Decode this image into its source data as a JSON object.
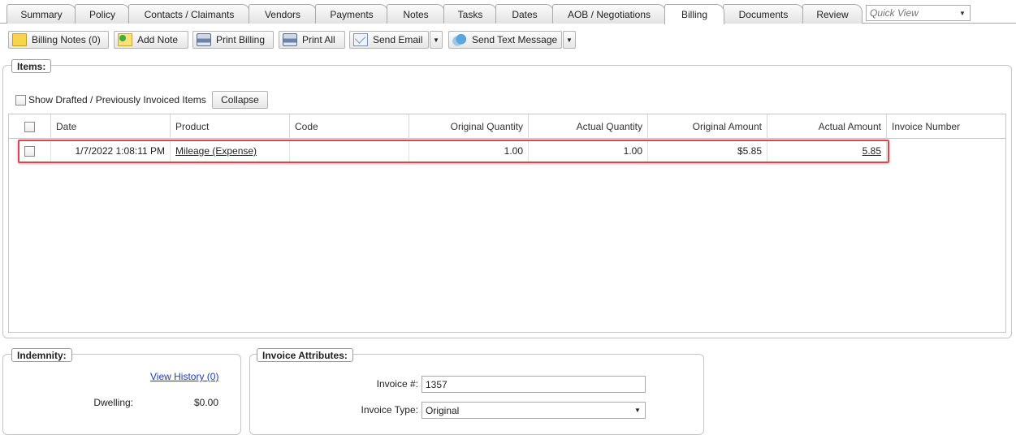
{
  "tabs": [
    {
      "label": "Summary"
    },
    {
      "label": "Policy"
    },
    {
      "label": "Contacts / Claimants"
    },
    {
      "label": "Vendors"
    },
    {
      "label": "Payments"
    },
    {
      "label": "Notes"
    },
    {
      "label": "Tasks"
    },
    {
      "label": "Dates"
    },
    {
      "label": "AOB / Negotiations"
    },
    {
      "label": "Billing",
      "active": true
    },
    {
      "label": "Documents"
    },
    {
      "label": "Review"
    }
  ],
  "quick_view": {
    "placeholder": "Quick View"
  },
  "toolbar": {
    "billing_notes": "Billing Notes (0)",
    "add_note": "Add Note",
    "print_billing": "Print Billing",
    "print_all": "Print All",
    "send_email": "Send Email",
    "send_text": "Send Text Message"
  },
  "items": {
    "legend": "Items:",
    "show_drafted_label": "Show Drafted / Previously Invoiced Items",
    "collapse_label": "Collapse",
    "columns": {
      "date": "Date",
      "product": "Product",
      "code": "Code",
      "original_quantity": "Original Quantity",
      "actual_quantity": "Actual Quantity",
      "original_amount": "Original Amount",
      "actual_amount": "Actual Amount",
      "invoice_number": "Invoice Number"
    },
    "rows": [
      {
        "date": "1/7/2022 1:08:11 PM",
        "product": "Mileage (Expense)",
        "code": "",
        "original_quantity": "1.00",
        "actual_quantity": "1.00",
        "original_amount": "$5.85",
        "actual_amount": "5.85",
        "invoice_number": ""
      }
    ]
  },
  "indemnity": {
    "legend": "Indemnity:",
    "view_history": "View History (0)",
    "dwelling_label": "Dwelling:",
    "dwelling_value": "$0.00"
  },
  "invoice_attributes": {
    "legend": "Invoice Attributes:",
    "invoice_number_label": "Invoice #:",
    "invoice_number_value": "1357",
    "invoice_type_label": "Invoice Type:",
    "invoice_type_value": "Original"
  },
  "colors": {
    "highlight": "#e0454e",
    "link_blue": "#1a3cc8"
  }
}
